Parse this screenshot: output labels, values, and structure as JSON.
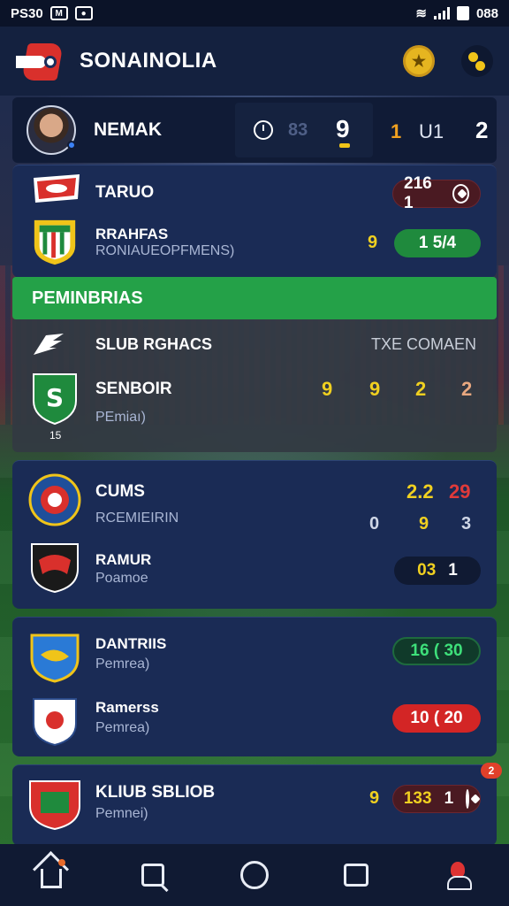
{
  "status_bar": {
    "left_text": "PS30",
    "right_text": "088"
  },
  "header": {
    "title": "SONAINOLIA"
  },
  "featured": {
    "player_name": "NEMAK",
    "stat_dim": "83",
    "stat_big": "9",
    "stat_slash": "1",
    "stat_val": "U1",
    "stat_last": "2"
  },
  "card1": {
    "team_a_name": "TARUO",
    "team_a_score": "216 1",
    "team_b_name": "RRAHFAS",
    "team_b_sub": "RONIAUEOPFMENS)",
    "team_b_mark": "9",
    "team_b_score": "1 5/4"
  },
  "section": {
    "title": "PEMINBRIAS"
  },
  "grey_card": {
    "header_name": "SLUB RGHACS",
    "header_right": "TXE COMAEN",
    "team_name": "SENBOIR",
    "team_sub": "PEmiaı)",
    "crest_caption": "15",
    "values": [
      "9",
      "9",
      "2",
      "2"
    ]
  },
  "card2": {
    "team_a_name": "CUMS",
    "team_a_sub": "RCEMIEIRIN",
    "score_yellow": "2.2",
    "score_red": "29",
    "row_vals": [
      "0",
      "9",
      "3"
    ],
    "team_b_name": "RAMUR",
    "team_b_sub": "Poamoe",
    "team_b_score_a": "03",
    "team_b_score_b": "1"
  },
  "card3": {
    "team_a_name": "DANTRIIS",
    "team_a_sub": "Pemrea)",
    "team_a_score": "16 ( 30",
    "team_b_name": "Ramerss",
    "team_b_sub": "Pemrea)",
    "team_b_score": "10 ( 20"
  },
  "card4": {
    "team_name": "KLIUB SBLIOB",
    "team_sub": "Pemnei)",
    "mark": "9",
    "score_a": "133",
    "score_b": "1",
    "badge": "2"
  },
  "colors": {
    "accent_green": "#24a148",
    "accent_yellow": "#f0d020",
    "accent_red": "#d32525",
    "card_bg": "#1a2b55"
  },
  "icons": [
    "home-icon",
    "search-icon",
    "circle-icon",
    "chat-icon",
    "profile-icon",
    "trophy-icon",
    "menu-icon",
    "clock-icon",
    "ball-icon"
  ]
}
